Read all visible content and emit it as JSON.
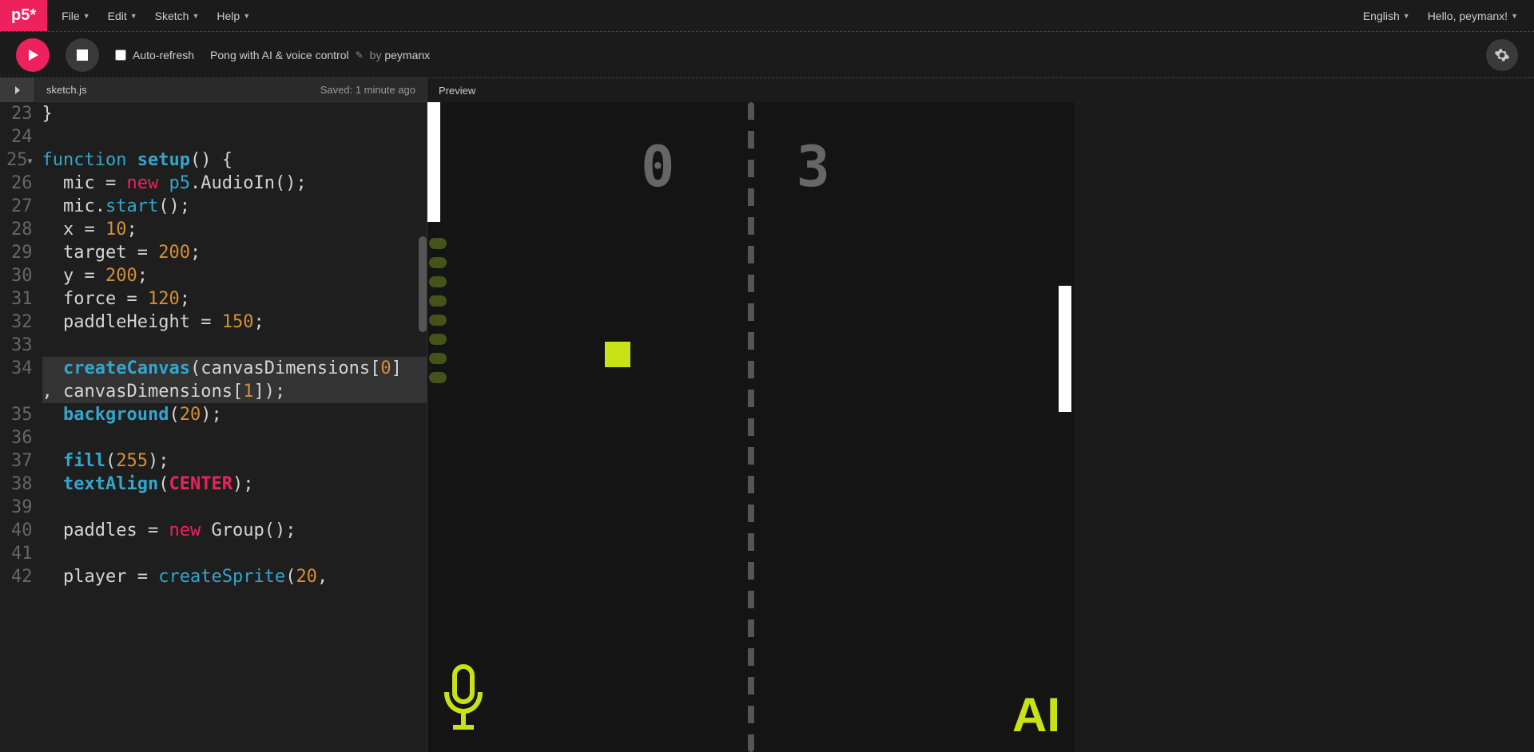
{
  "logo": "p5*",
  "menus": {
    "file": "File",
    "edit": "Edit",
    "sketch": "Sketch",
    "help": "Help"
  },
  "topbar_right": {
    "language": "English",
    "greeting": "Hello, peymanx!"
  },
  "toolbar": {
    "auto_refresh": "Auto-refresh",
    "sketch_title": "Pong with AI & voice control",
    "by": "by",
    "author": "peymanx"
  },
  "editor_header": {
    "filename": "sketch.js",
    "saved": "Saved: 1 minute ago"
  },
  "preview_label": "Preview",
  "code": {
    "lines": [
      {
        "n": "23",
        "t": "}"
      },
      {
        "n": "24",
        "t": ""
      },
      {
        "n": "25",
        "fold": true,
        "t_html": "<span class='kw'>function</span> <span class='fn'>setup</span>() {"
      },
      {
        "n": "26",
        "t_html": "  mic = <span class='new'>new</span> <span class='id'>p5</span>.AudioIn();"
      },
      {
        "n": "27",
        "t_html": "  mic.<span class='id'>start</span>();"
      },
      {
        "n": "28",
        "t_html": "  x = <span class='num'>10</span>;"
      },
      {
        "n": "29",
        "t_html": "  target = <span class='num'>200</span>;"
      },
      {
        "n": "30",
        "t_html": "  y = <span class='num'>200</span>;"
      },
      {
        "n": "31",
        "t_html": "  force = <span class='num'>120</span>;"
      },
      {
        "n": "32",
        "t_html": "  paddleHeight = <span class='num'>150</span>;"
      },
      {
        "n": "33",
        "t": ""
      },
      {
        "n": "34",
        "wrap": true,
        "hl": true,
        "t_html": "  <span class='fn'>createCanvas</span>(canvasDimensions[<span class='num'>0</span>]<br>, canvasDimensions[<span class='num'>1</span>]);"
      },
      {
        "n": "35",
        "t_html": "  <span class='fn'>background</span>(<span class='num'>20</span>);"
      },
      {
        "n": "36",
        "t": ""
      },
      {
        "n": "37",
        "t_html": "  <span class='fn'>fill</span>(<span class='num'>255</span>);"
      },
      {
        "n": "38",
        "t_html": "  <span class='fn'>textAlign</span>(<span class='const'>CENTER</span>);"
      },
      {
        "n": "39",
        "t": ""
      },
      {
        "n": "40",
        "t_html": "  paddles = <span class='new'>new</span> Group();"
      },
      {
        "n": "41",
        "t": ""
      },
      {
        "n": "42",
        "t_html": "  player = <span class='id'>createSprite</span>(<span class='num'>20</span>,"
      }
    ]
  },
  "game": {
    "score_left": "0",
    "score_right": "3",
    "ai_label": "AI"
  }
}
